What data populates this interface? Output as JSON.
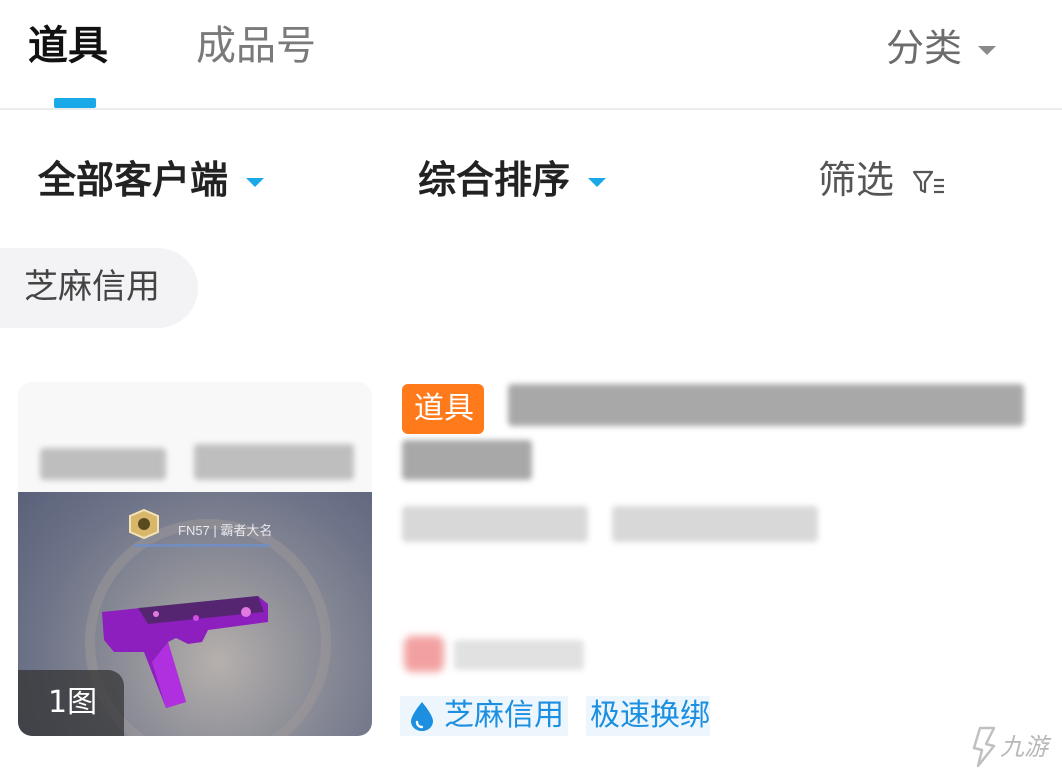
{
  "tabs": {
    "active_label": "道具",
    "inactive_label": "成品号",
    "category_label": "分类"
  },
  "filters": {
    "client_label": "全部客户端",
    "sort_label": "综合排序",
    "screen_label": "筛选"
  },
  "chip": {
    "label": "芝麻信用"
  },
  "listing": {
    "type_tag": "道具",
    "image_count": "1图",
    "weapon_name": "FN57 | 霸者大名",
    "credit_badge": "芝麻信用",
    "swap_badge": "极速换绑"
  },
  "colors": {
    "accent_blue": "#1aa9e8",
    "tag_orange": "#ff7a1a",
    "badge_blue": "#1c8fe0"
  },
  "watermark": {
    "text": "九游"
  }
}
